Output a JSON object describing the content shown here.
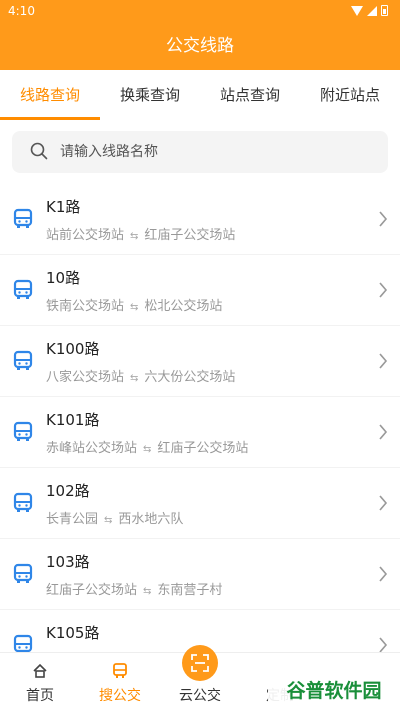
{
  "status": {
    "time": "4:10"
  },
  "title": "公交线路",
  "tabs": [
    "线路查询",
    "换乘查询",
    "站点查询",
    "附近站点"
  ],
  "search": {
    "placeholder": "请输入线路名称"
  },
  "routes": [
    {
      "name": "K1路",
      "from": "站前公交场站",
      "to": "红庙子公交场站"
    },
    {
      "name": "10路",
      "from": "铁南公交场站",
      "to": "松北公交场站"
    },
    {
      "name": "K100路",
      "from": "八家公交场站",
      "to": "六大份公交场站"
    },
    {
      "name": "K101路",
      "from": "赤峰站公交场站",
      "to": "红庙子公交场站"
    },
    {
      "name": "102路",
      "from": "长青公园",
      "to": "西水地六队"
    },
    {
      "name": "103路",
      "from": "红庙子公交场站",
      "to": "东南营子村"
    },
    {
      "name": "K105路",
      "from": "",
      "to": ""
    }
  ],
  "nav": {
    "home": "首页",
    "search_bus": "搜公交",
    "cloud_bus": "云公交",
    "custom": "定制"
  },
  "watermark": "谷普软件园",
  "colors": {
    "accent": "#ff9a1a",
    "accent_text": "#ff8c00",
    "bus_icon": "#2f86e8"
  }
}
